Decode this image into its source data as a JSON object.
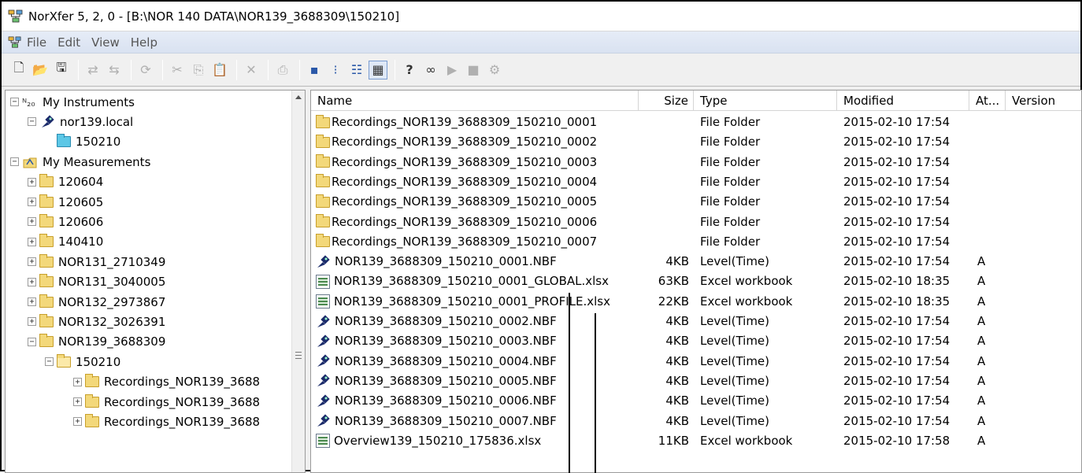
{
  "window": {
    "title": "NorXfer 5, 2, 0 - [B:\\NOR 140 DATA\\NOR139_3688309\\150210]"
  },
  "menu": {
    "items": [
      "File",
      "Edit",
      "View",
      "Help"
    ]
  },
  "toolbar": {
    "icons": [
      "new-icon",
      "open-icon",
      "save-icon",
      "connect-icon",
      "disconnect-icon",
      "refresh-icon",
      "cut-icon",
      "copy-icon",
      "paste-icon",
      "delete-icon",
      "print-icon",
      "large-icons-icon",
      "small-icons-icon",
      "list-view-icon",
      "details-view-icon",
      "help-icon",
      "about-icon",
      "play-icon",
      "stop-icon",
      "plugin-icon"
    ]
  },
  "tree": {
    "items": [
      {
        "label": "My Instruments",
        "level": 0,
        "expander": "−",
        "icon": "instruments-icon"
      },
      {
        "label": "nor139.local",
        "level": 1,
        "expander": "−",
        "icon": "instrument-icon"
      },
      {
        "label": "150210",
        "level": 2,
        "expander": "",
        "icon": "folder-cyan-icon"
      },
      {
        "label": "My Measurements",
        "level": 0,
        "expander": "−",
        "icon": "measurements-icon"
      },
      {
        "label": "120604",
        "level": 1,
        "expander": "+",
        "icon": "folder-icon"
      },
      {
        "label": "120605",
        "level": 1,
        "expander": "+",
        "icon": "folder-icon"
      },
      {
        "label": "120606",
        "level": 1,
        "expander": "+",
        "icon": "folder-icon"
      },
      {
        "label": "140410",
        "level": 1,
        "expander": "+",
        "icon": "folder-icon"
      },
      {
        "label": "NOR131_2710349",
        "level": 1,
        "expander": "+",
        "icon": "folder-icon"
      },
      {
        "label": "NOR131_3040005",
        "level": 1,
        "expander": "+",
        "icon": "folder-icon"
      },
      {
        "label": "NOR132_2973867",
        "level": 1,
        "expander": "+",
        "icon": "folder-icon"
      },
      {
        "label": "NOR132_3026391",
        "level": 1,
        "expander": "+",
        "icon": "folder-icon"
      },
      {
        "label": "NOR139_3688309",
        "level": 1,
        "expander": "−",
        "icon": "folder-icon"
      },
      {
        "label": "150210",
        "level": 2,
        "expander": "−",
        "icon": "folder-open-icon"
      },
      {
        "label": "Recordings_NOR139_3688",
        "level": 3,
        "expander": "+",
        "icon": "folder-icon"
      },
      {
        "label": "Recordings_NOR139_3688",
        "level": 3,
        "expander": "+",
        "icon": "folder-icon"
      },
      {
        "label": "Recordings_NOR139_3688",
        "level": 3,
        "expander": "+",
        "icon": "folder-icon"
      }
    ]
  },
  "list": {
    "columns": [
      "Name",
      "Size",
      "Type",
      "Modified",
      "At...",
      "Version"
    ],
    "rows": [
      {
        "icon": "folder-icon",
        "name": "Recordings_NOR139_3688309_150210_0001",
        "size": "",
        "type": "File Folder",
        "modified": "2015-02-10 17:54",
        "attr": ""
      },
      {
        "icon": "folder-icon",
        "name": "Recordings_NOR139_3688309_150210_0002",
        "size": "",
        "type": "File Folder",
        "modified": "2015-02-10 17:54",
        "attr": ""
      },
      {
        "icon": "folder-icon",
        "name": "Recordings_NOR139_3688309_150210_0003",
        "size": "",
        "type": "File Folder",
        "modified": "2015-02-10 17:54",
        "attr": ""
      },
      {
        "icon": "folder-icon",
        "name": "Recordings_NOR139_3688309_150210_0004",
        "size": "",
        "type": "File Folder",
        "modified": "2015-02-10 17:54",
        "attr": ""
      },
      {
        "icon": "folder-icon",
        "name": "Recordings_NOR139_3688309_150210_0005",
        "size": "",
        "type": "File Folder",
        "modified": "2015-02-10 17:54",
        "attr": ""
      },
      {
        "icon": "folder-icon",
        "name": "Recordings_NOR139_3688309_150210_0006",
        "size": "",
        "type": "File Folder",
        "modified": "2015-02-10 17:54",
        "attr": ""
      },
      {
        "icon": "folder-icon",
        "name": "Recordings_NOR139_3688309_150210_0007",
        "size": "",
        "type": "File Folder",
        "modified": "2015-02-10 17:54",
        "attr": ""
      },
      {
        "icon": "instrument-file-icon",
        "name": "NOR139_3688309_150210_0001.NBF",
        "size": "4KB",
        "type": "Level(Time)",
        "modified": "2015-02-10 17:54",
        "attr": "A"
      },
      {
        "icon": "excel-icon",
        "name": "NOR139_3688309_150210_0001_GLOBAL.xlsx",
        "size": "63KB",
        "type": "Excel workbook",
        "modified": "2015-02-10 18:35",
        "attr": "A"
      },
      {
        "icon": "excel-icon",
        "name": "NOR139_3688309_150210_0001_PROFILE.xlsx",
        "size": "22KB",
        "type": "Excel workbook",
        "modified": "2015-02-10 18:35",
        "attr": "A"
      },
      {
        "icon": "instrument-file-icon",
        "name": "NOR139_3688309_150210_0002.NBF",
        "size": "4KB",
        "type": "Level(Time)",
        "modified": "2015-02-10 17:54",
        "attr": "A"
      },
      {
        "icon": "instrument-file-icon",
        "name": "NOR139_3688309_150210_0003.NBF",
        "size": "4KB",
        "type": "Level(Time)",
        "modified": "2015-02-10 17:54",
        "attr": "A"
      },
      {
        "icon": "instrument-file-icon",
        "name": "NOR139_3688309_150210_0004.NBF",
        "size": "4KB",
        "type": "Level(Time)",
        "modified": "2015-02-10 17:54",
        "attr": "A"
      },
      {
        "icon": "instrument-file-icon",
        "name": "NOR139_3688309_150210_0005.NBF",
        "size": "4KB",
        "type": "Level(Time)",
        "modified": "2015-02-10 17:54",
        "attr": "A"
      },
      {
        "icon": "instrument-file-icon",
        "name": "NOR139_3688309_150210_0006.NBF",
        "size": "4KB",
        "type": "Level(Time)",
        "modified": "2015-02-10 17:54",
        "attr": "A"
      },
      {
        "icon": "instrument-file-icon",
        "name": "NOR139_3688309_150210_0007.NBF",
        "size": "4KB",
        "type": "Level(Time)",
        "modified": "2015-02-10 17:54",
        "attr": "A"
      },
      {
        "icon": "excel-icon",
        "name": "Overview139_150210_175836.xlsx",
        "size": "11KB",
        "type": "Excel workbook",
        "modified": "2015-02-10 17:58",
        "attr": "A"
      }
    ]
  }
}
